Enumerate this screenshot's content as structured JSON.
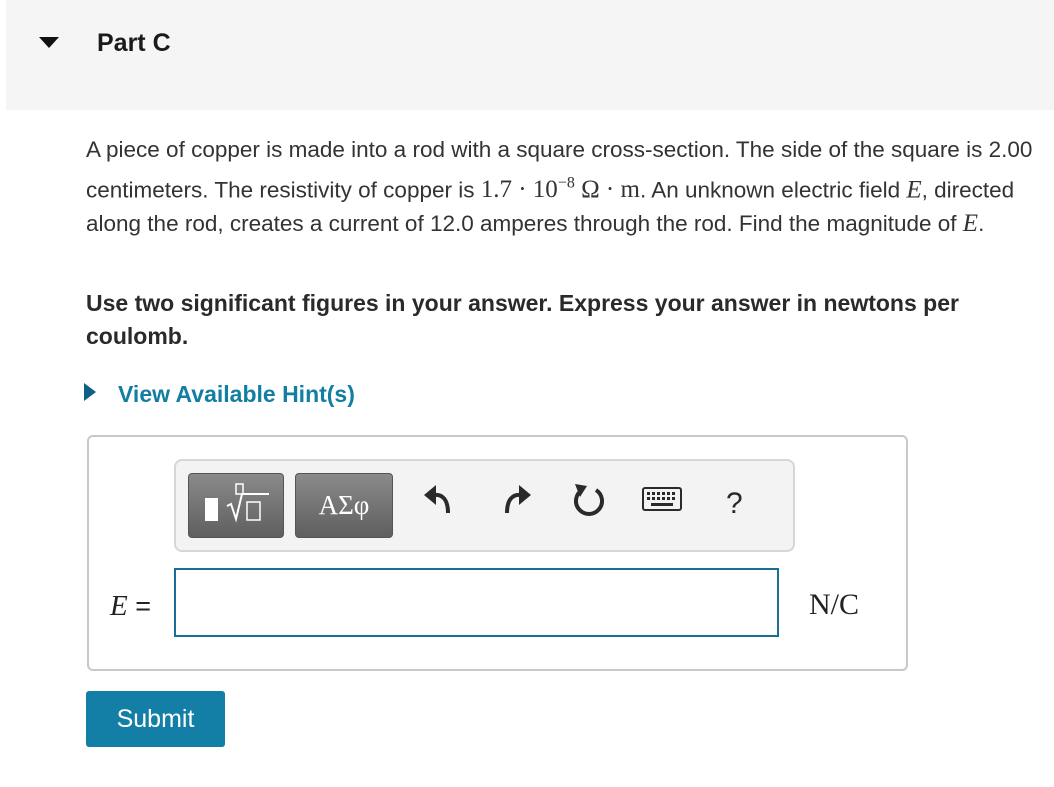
{
  "part": {
    "title": "Part C"
  },
  "question": {
    "text_1": "A piece of copper is made into a rod with a square cross-section. The side of the square is 2.00 centimeters. The resistivity of copper is ",
    "resistivity_base": "1.7 · 10",
    "resistivity_exp": "−8",
    "resistivity_unit": " Ω · m",
    "text_2": ". An unknown electric field ",
    "var_e_1": "E",
    "text_3": ", directed along the rod, creates a current of 12.0 amperes through the rod. Find the magnitude of ",
    "var_e_2": "E",
    "text_4": "."
  },
  "instruction": "Use two significant figures in your answer. Express your answer in newtons per coulomb.",
  "hint": {
    "label": "View Available Hint(s)"
  },
  "toolbar": {
    "greek_label": "ΑΣφ",
    "help_label": "?",
    "icons": [
      "templates-icon",
      "greek-symbols-icon",
      "undo-icon",
      "redo-icon",
      "reset-icon",
      "keyboard-icon",
      "help-icon"
    ]
  },
  "answer": {
    "variable": "E",
    "equals": " =",
    "value": "",
    "placeholder": "",
    "unit": "N/C"
  },
  "submit": {
    "label": "Submit"
  },
  "colors": {
    "accent": "#137ea6",
    "link": "#127ea2",
    "header_bg": "#f5f5f5",
    "input_border": "#1a6f96"
  }
}
